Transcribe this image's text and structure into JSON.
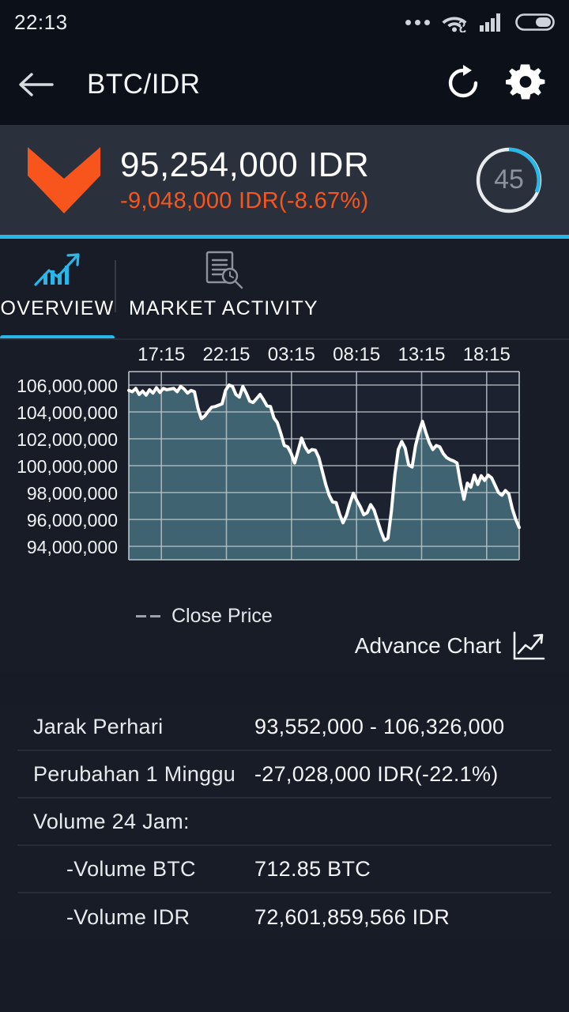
{
  "statusbar": {
    "time": "22:13",
    "icons": [
      "more-dots",
      "wifi-vpn",
      "cellular-signal",
      "battery"
    ]
  },
  "appbar": {
    "back_label": "back-arrow",
    "title": "BTC/IDR",
    "refresh_label": "refresh",
    "settings_label": "settings"
  },
  "price": {
    "trend": "down",
    "value": "95,254,000 IDR",
    "change": "-9,048,000 IDR(-8.67%)",
    "countdown": "45",
    "accent": "#29b6e8",
    "down_color": "#f8551c"
  },
  "tabs": [
    {
      "label": "OVERVIEW",
      "icon": "bar-chart-trend-icon",
      "active": true
    },
    {
      "label": "MARKET ACTIVITY",
      "icon": "document-search-icon",
      "active": false
    }
  ],
  "chart_meta": {
    "legend_label": "Close Price",
    "advance_label": "Advance Chart",
    "advance_icon": "line-chart-icon"
  },
  "chart_data": {
    "type": "area",
    "title": "",
    "xlabel": "",
    "ylabel": "",
    "grid": true,
    "legend": [
      "Close Price"
    ],
    "legend_position": "below-left",
    "line_color": "#ffffff",
    "fill_color": "#3f6370",
    "plot_bg": "#1d2230",
    "xlim_labels": [
      "17:15",
      "22:15",
      "03:15",
      "08:15",
      "13:15",
      "18:15"
    ],
    "xticks": [
      "17:15",
      "22:15",
      "03:15",
      "08:15",
      "13:15",
      "18:15"
    ],
    "ylim": [
      93000000,
      107000000
    ],
    "yticks": [
      106000000,
      104000000,
      102000000,
      100000000,
      98000000,
      96000000,
      94000000
    ],
    "ytick_labels": [
      "106,000,000",
      "104,000,000",
      "102,000,000",
      "100,000,000",
      "98,000,000",
      "96,000,000",
      "94,000,000"
    ],
    "series": [
      {
        "name": "Close Price",
        "values": [
          105600000,
          105500000,
          105750000,
          105300000,
          105550000,
          105250000,
          105650000,
          105400000,
          105800000,
          105450000,
          105750000,
          105650000,
          105700000,
          105750000,
          105500000,
          105900000,
          105700000,
          105400000,
          105600000,
          105500000,
          104300000,
          103500000,
          103700000,
          104050000,
          104350000,
          104400000,
          104500000,
          104600000,
          105600000,
          106000000,
          105900000,
          105300000,
          105100000,
          105900000,
          105400000,
          104800000,
          104700000,
          105000000,
          105300000,
          104900000,
          104450000,
          104400000,
          103550000,
          103200000,
          102400000,
          101500000,
          101400000,
          100900000,
          100200000,
          101100000,
          102050000,
          101400000,
          101000000,
          101200000,
          101150000,
          100600000,
          99600000,
          98600000,
          97800000,
          97300000,
          97250000,
          96400000,
          95750000,
          96300000,
          97200000,
          97950000,
          97400000,
          96950000,
          96350000,
          96500000,
          97100000,
          96700000,
          95900000,
          95100000,
          94450000,
          94600000,
          96600000,
          99300000,
          101200000,
          101800000,
          101300000,
          100050000,
          99900000,
          101500000,
          102500000,
          103300000,
          102450000,
          101700000,
          101200000,
          101500000,
          101400000,
          100900000,
          100600000,
          100450000,
          100350000,
          100200000,
          98700000,
          97500000,
          98700000,
          98400000,
          99300000,
          98600000,
          99250000,
          98900000,
          99300000,
          99100000,
          98550000,
          98000000,
          97800000,
          98150000,
          97900000,
          96800000,
          96000000,
          95400000
        ]
      }
    ]
  },
  "stats": {
    "rows": [
      {
        "label": "Jarak Perhari",
        "value": "93,552,000 - 106,326,000",
        "indent": false,
        "header": false
      },
      {
        "label": "Perubahan 1 Minggu",
        "value": "-27,028,000 IDR(-22.1%)",
        "indent": false,
        "header": false
      },
      {
        "label": "Volume 24 Jam:",
        "value": "",
        "indent": false,
        "header": true
      },
      {
        "label": "-Volume BTC",
        "value": "712.85 BTC",
        "indent": true,
        "header": false
      },
      {
        "label": "-Volume IDR",
        "value": "72,601,859,566 IDR",
        "indent": true,
        "header": false
      }
    ]
  }
}
